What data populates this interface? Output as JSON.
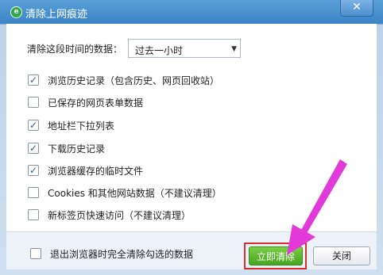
{
  "window": {
    "title": "清除上网痕迹",
    "close_glyph": "✕"
  },
  "range": {
    "label": "清除这段时间的数据：",
    "selected": "过去一小时"
  },
  "options": [
    {
      "label": "浏览历史记录（包含历史、网页回收站）",
      "checked": true
    },
    {
      "label": "已保存的网页表单数据",
      "checked": false
    },
    {
      "label": "地址栏下拉列表",
      "checked": true
    },
    {
      "label": "下载历史记录",
      "checked": true
    },
    {
      "label": "浏览器缓存的临时文件",
      "checked": true
    },
    {
      "label": "Cookies 和其他网站数据（不建议清理）",
      "checked": false
    },
    {
      "label": "新标签页快速访问（不建议清理）",
      "checked": false
    }
  ],
  "footer": {
    "exit_clear_label": "退出浏览器时完全清除勾选的数据",
    "exit_clear_checked": false,
    "clear_button": "立即清除",
    "close_button": "关闭"
  },
  "colors": {
    "accent_green": "#46a520",
    "highlight_red": "#d62f2f",
    "annotation_arrow": "#e23ad8"
  }
}
